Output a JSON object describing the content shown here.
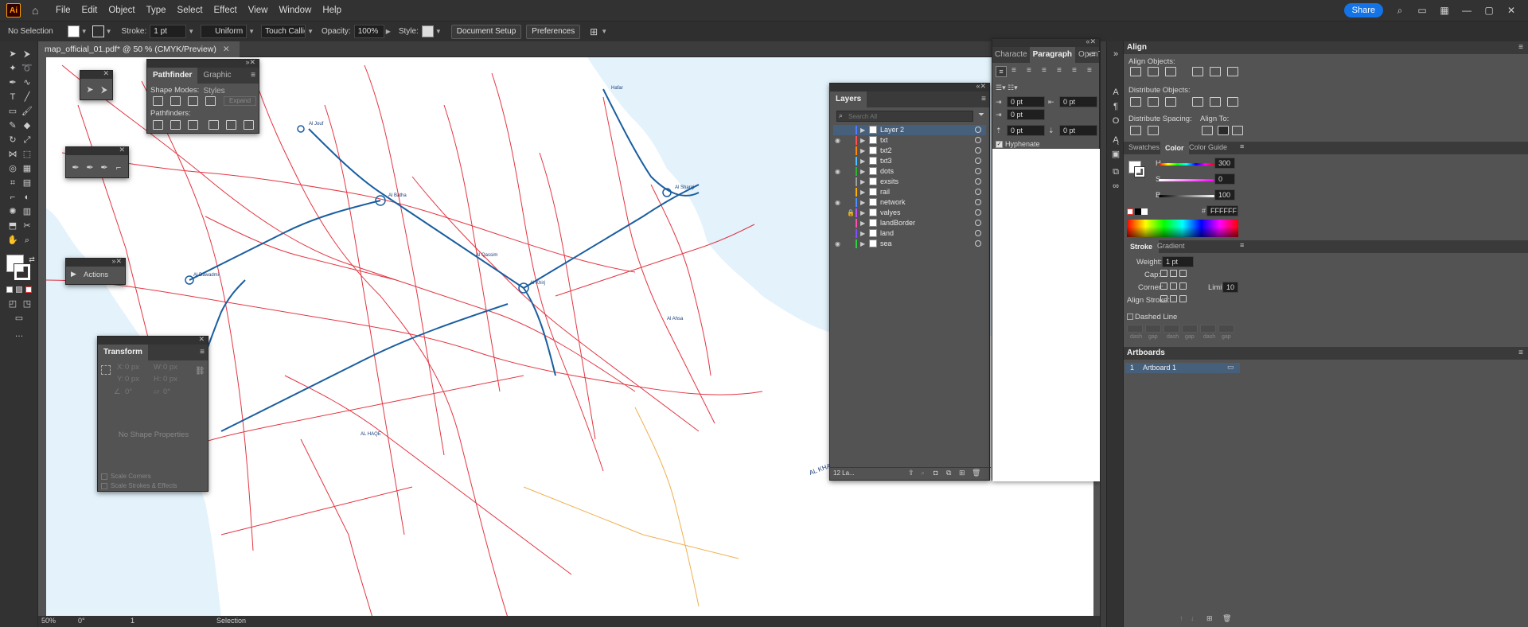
{
  "app": {
    "logo": "Ai",
    "menus": [
      "File",
      "Edit",
      "Object",
      "Type",
      "Select",
      "Effect",
      "View",
      "Window",
      "Help"
    ],
    "share_label": "Share"
  },
  "controlbar": {
    "selection_label": "No Selection",
    "stroke_label": "Stroke:",
    "stroke_value": "1 pt",
    "profile_value": "Uniform",
    "brush_value": "Touch Callig...",
    "opacity_label": "Opacity:",
    "opacity_value": "100%",
    "style_label": "Style:",
    "document_setup": "Document Setup",
    "preferences": "Preferences"
  },
  "document": {
    "tab_title": "map_official_01.pdf* @ 50 % (CMYK/Preview)"
  },
  "statusbar": {
    "zoom": "50%",
    "rotation": "0°",
    "artboard_number": "1",
    "tool_name": "Selection"
  },
  "pathfinder": {
    "tabs": [
      "Pathfinder",
      "Graphic Styles"
    ],
    "shape_modes_label": "Shape Modes:",
    "expand_label": "Expand",
    "pathfinders_label": "Pathfinders:"
  },
  "actions": {
    "label": "Actions"
  },
  "transform": {
    "title": "Transform",
    "x_label": "X:",
    "x_value": "0 px",
    "y_label": "Y:",
    "y_value": "0 px",
    "w_label": "W:",
    "w_value": "0 px",
    "h_label": "H:",
    "h_value": "0 px",
    "angle_value": "0°",
    "shear_value": "0°",
    "no_shape": "No Shape Properties",
    "scale_corners": "Scale Corners",
    "scale_strokes": "Scale Strokes & Effects"
  },
  "layers": {
    "title": "Layers",
    "search_placeholder": "Search All",
    "footer_count": "12 La...",
    "items": [
      {
        "name": "Layer 2",
        "color": "#4f7dff",
        "visible": false,
        "locked": false,
        "selected": true
      },
      {
        "name": "txt",
        "color": "#ff4f4f",
        "visible": true,
        "locked": false,
        "selected": false
      },
      {
        "name": "txt2",
        "color": "#ff8a00",
        "visible": false,
        "locked": false,
        "selected": false
      },
      {
        "name": "txt3",
        "color": "#4fc3ff",
        "visible": false,
        "locked": false,
        "selected": false
      },
      {
        "name": "dots",
        "color": "#2eb82e",
        "visible": true,
        "locked": false,
        "selected": false
      },
      {
        "name": "exsits",
        "color": "#a0a0a0",
        "visible": false,
        "locked": false,
        "selected": false
      },
      {
        "name": "rail",
        "color": "#ffb000",
        "visible": false,
        "locked": false,
        "selected": false
      },
      {
        "name": "network",
        "color": "#4f8fff",
        "visible": true,
        "locked": false,
        "selected": false
      },
      {
        "name": "valyes",
        "color": "#c04fff",
        "visible": false,
        "locked": true,
        "selected": false
      },
      {
        "name": "landBorder",
        "color": "#ff4fb0",
        "visible": false,
        "locked": false,
        "selected": false
      },
      {
        "name": "land",
        "color": "#7f4fff",
        "visible": false,
        "locked": false,
        "selected": false
      },
      {
        "name": "sea",
        "color": "#30d040",
        "visible": true,
        "locked": false,
        "selected": false
      }
    ]
  },
  "paragraph": {
    "tabs": [
      "Characte",
      "Paragraph",
      "OpenTy"
    ],
    "indent_left": "0 pt",
    "indent_right": "0 pt",
    "indent_first": "0 pt",
    "space_before": "0 pt",
    "space_after": "0 pt",
    "hyphenate": "Hyphenate"
  },
  "align": {
    "title": "Align",
    "align_objects": "Align Objects:",
    "distribute_objects": "Distribute Objects:",
    "distribute_spacing": "Distribute Spacing:",
    "align_to": "Align To:"
  },
  "color": {
    "tabs": [
      "Swatches",
      "Color",
      "Color Guide"
    ],
    "h_label": "H",
    "h_value": "300",
    "s_label": "S",
    "s_value": "0",
    "b_label": "B",
    "b_value": "100",
    "hex_value": "FFFFFF"
  },
  "stroke": {
    "tabs": [
      "Stroke",
      "Gradient"
    ],
    "weight_label": "Weight:",
    "weight_value": "1 pt",
    "cap_label": "Cap:",
    "corner_label": "Corner:",
    "limit_label": "Limit:",
    "limit_value": "10",
    "align_stroke_label": "Align Stroke:",
    "dashed_line": "Dashed Line",
    "dash_labels": [
      "dash",
      "gap",
      "dash",
      "gap",
      "dash",
      "gap"
    ]
  },
  "artboards": {
    "title": "Artboards",
    "items": [
      {
        "number": "1",
        "name": "Artboard 1"
      }
    ]
  },
  "map": {
    "labels": [
      "AL KHALI",
      "AL HAQE",
      "Al Khirj",
      "Al Batha",
      "Al Sharqi",
      "Al Dawadmi",
      "Al Jouf",
      "Al Qassim",
      "Hafar",
      "Al Ahsa"
    ]
  }
}
